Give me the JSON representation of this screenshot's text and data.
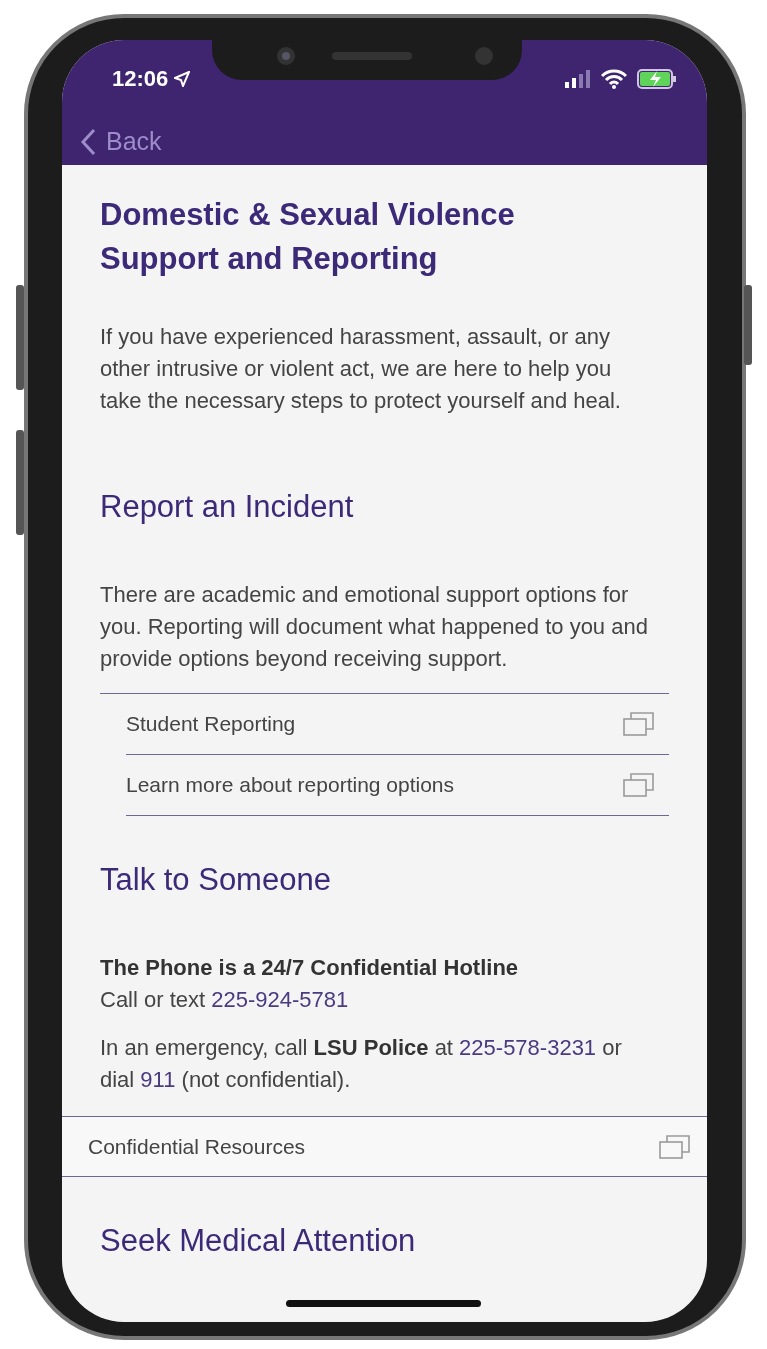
{
  "status_bar": {
    "time": "12:06"
  },
  "nav_bar": {
    "back_label": "Back"
  },
  "title": "Domestic & Sexual Violence Support and Reporting",
  "intro": "If you have experienced harassment, assault, or any other intrusive or violent act, we are here to help you take the necessary steps to protect yourself and heal.",
  "sections": [
    {
      "heading": "Report an Incident",
      "paragraphs": [
        [
          {
            "text": "There are academic and emotional support options for you. Reporting will document what happened to you and provide options beyond receiving support."
          }
        ]
      ],
      "links": [
        "Student Reporting",
        "Learn more about reporting options"
      ],
      "kind": "inset"
    },
    {
      "heading": "Talk to Someone",
      "paragraphs": [
        [
          {
            "text": "The Phone is a 24/7 Confidential Hotline",
            "kind": "bold_line"
          },
          {
            "text": "Call or text "
          },
          {
            "text": "225-924-5781",
            "kind": "link"
          }
        ],
        [
          {
            "text": "In an emergency, call "
          },
          {
            "text": "LSU Police",
            "kind": "bold"
          },
          {
            "text": " at "
          },
          {
            "text": "225-578-3231",
            "kind": "link"
          },
          {
            "text": " or dial "
          },
          {
            "text": "911",
            "kind": "link"
          },
          {
            "text": " (not confidential)."
          }
        ]
      ],
      "links": [
        "Confidential Resources"
      ],
      "kind": "full"
    },
    {
      "heading": "Seek Medical Attention"
    }
  ]
}
